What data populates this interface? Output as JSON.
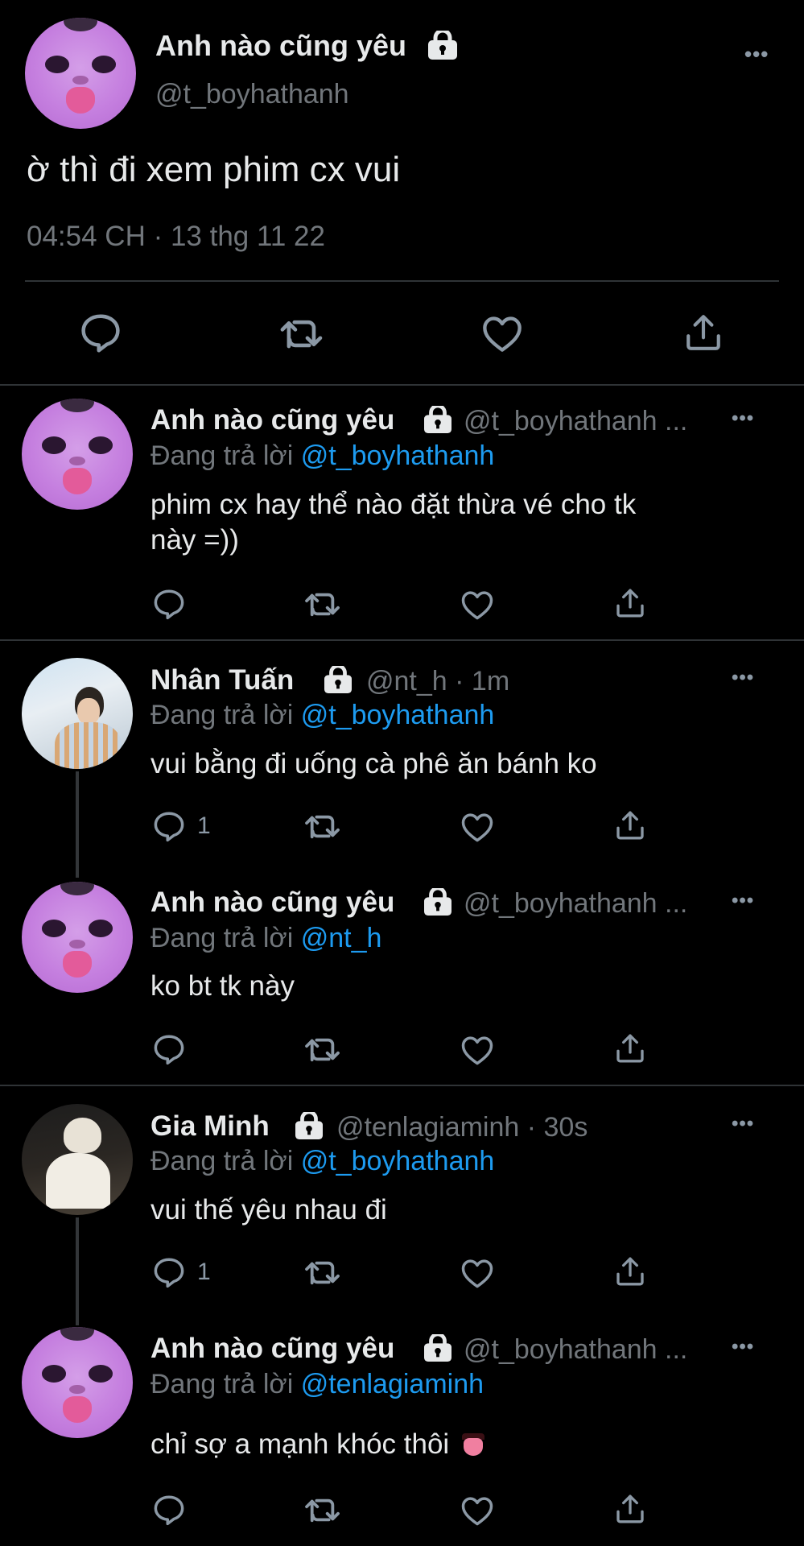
{
  "main_tweet": {
    "display_name": "Anh nào cũng yêu",
    "handle": "@t_boyhathanh",
    "text": "ờ thì đi xem phim cx vui",
    "timestamp": "04:54 CH · 13 thg 11 22",
    "more": "•••"
  },
  "replies": [
    {
      "display_name": "Anh nào cũng yêu",
      "handle_meta": "@t_boyhathanh ...",
      "replying_prefix": "Đang trả lời ",
      "replying_to": "@t_boyhathanh",
      "text_line1": "phim cx hay thể nào đặt thừa vé cho tk",
      "text_line2": "này =))",
      "reply_count": "",
      "more": "•••"
    },
    {
      "display_name": "Nhân Tuấn",
      "handle_meta": "@nt_h · 1m",
      "replying_prefix": "Đang trả lời ",
      "replying_to": "@t_boyhathanh",
      "text_line1": "vui bằng đi uống cà phê ăn bánh ko",
      "reply_count": "1",
      "more": "•••"
    },
    {
      "display_name": "Anh nào cũng yêu",
      "handle_meta": "@t_boyhathanh ...",
      "replying_prefix": "Đang trả lời ",
      "replying_to": "@nt_h",
      "text_line1": "ko bt tk này",
      "reply_count": "",
      "more": "•••"
    },
    {
      "display_name": "Gia Minh",
      "handle_meta": "@tenlagiaminh · 30s",
      "replying_prefix": "Đang trả lời ",
      "replying_to": "@t_boyhathanh",
      "text_line1": "vui thế yêu nhau đi",
      "reply_count": "1",
      "more": "•••"
    },
    {
      "display_name": "Anh nào cũng yêu",
      "handle_meta": "@t_boyhathanh ...",
      "replying_prefix": "Đang trả lời ",
      "replying_to": "@tenlagiaminh",
      "text_line1": "chỉ sợ a mạnh khóc thôi",
      "reply_count": "",
      "more": "•••"
    }
  ],
  "icons": [
    "lock-icon",
    "reply-icon",
    "retweet-icon",
    "like-icon",
    "share-icon",
    "more-icon"
  ],
  "colors": {
    "background": "#000000",
    "link": "#1d9bf0",
    "muted": "#71767b",
    "divider": "#2f3336"
  }
}
